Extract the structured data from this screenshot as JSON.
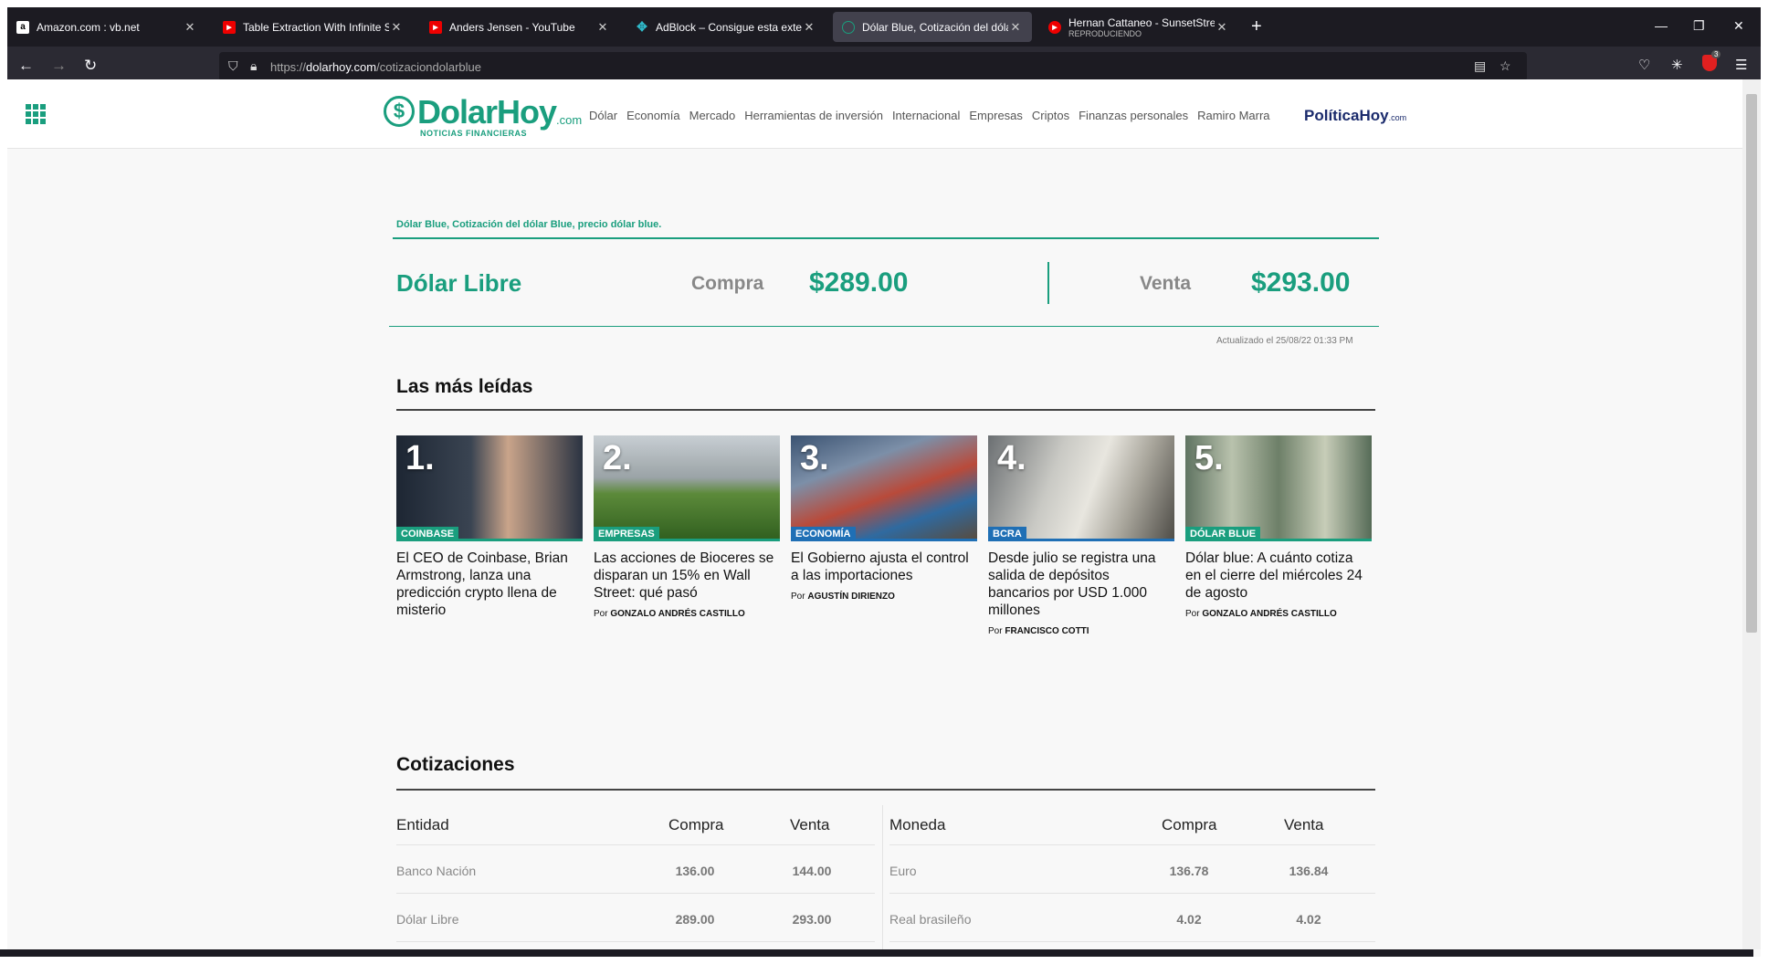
{
  "browser": {
    "tabs": [
      {
        "title": "Amazon.com : vb.net",
        "favicon": "amazon-icon"
      },
      {
        "title": "Table Extraction With Infinite Sc",
        "favicon": "youtube-icon"
      },
      {
        "title": "Anders Jensen - YouTube",
        "favicon": "youtube-icon"
      },
      {
        "title": "AdBlock – Consigue esta extens",
        "favicon": "adblock-icon"
      },
      {
        "title": "Dólar Blue, Cotización del dólar",
        "favicon": "globe-icon",
        "active": true
      },
      {
        "title": "Hernan Cattaneo - SunsetStrean",
        "subtitle": "REPRODUCIENDO",
        "favicon": "youtube-play-icon"
      }
    ],
    "url_prefix": "https://",
    "url_host": "dolarhoy.com",
    "url_path": "/cotizaciondolarblue",
    "extension_badge": "3"
  },
  "site": {
    "logo_main": "DolarHoy",
    "logo_com": ".com",
    "logo_tagline": "NOTICIAS FINANCIERAS",
    "menu": [
      "Dólar",
      "Economía",
      "Mercado",
      "Herramientas de inversión",
      "Internacional",
      "Empresas",
      "Criptos",
      "Finanzas personales",
      "Ramiro Marra"
    ],
    "partner_logo": "PolíticaHoy",
    "partner_com": ".com"
  },
  "quote": {
    "breadcrumb": "Dólar Blue, Cotización del dólar Blue, precio dólar blue.",
    "title": "Dólar Libre",
    "buy_label": "Compra",
    "buy_value": "$289.00",
    "sell_label": "Venta",
    "sell_value": "$293.00",
    "updated": "Actualizado el 25/08/22 01:33 PM"
  },
  "most_read": {
    "title": "Las más leídas",
    "cards": [
      {
        "num": "1.",
        "category": "COINBASE",
        "headline": "El CEO de Coinbase, Brian Armstrong, lanza una predicción crypto llena de misterio",
        "by_prefix": "",
        "author": ""
      },
      {
        "num": "2.",
        "category": "EMPRESAS",
        "headline": "Las acciones de Bioceres se disparan un 15% en Wall Street: qué pasó",
        "by_prefix": "Por",
        "author": "GONZALO ANDRÉS CASTILLO"
      },
      {
        "num": "3.",
        "category": "ECONOMÍA",
        "headline": "El Gobierno ajusta el control a las importaciones",
        "by_prefix": "Por",
        "author": "AGUSTÍN DIRIENZO"
      },
      {
        "num": "4.",
        "category": "BCRA",
        "headline": "Desde julio se registra una salida de depósitos bancarios por USD 1.000 millones",
        "by_prefix": "Por",
        "author": "FRANCISCO COTTI"
      },
      {
        "num": "5.",
        "category": "DÓLAR BLUE",
        "headline": "Dólar blue: A cuánto cotiza en el cierre del miércoles 24 de agosto",
        "by_prefix": "Por",
        "author": "GONZALO ANDRÉS CASTILLO"
      }
    ]
  },
  "quotes_table": {
    "title": "Cotizaciones",
    "left_headers": [
      "Entidad",
      "Compra",
      "Venta"
    ],
    "left_rows": [
      [
        "Banco Nación",
        "136.00",
        "144.00"
      ],
      [
        "Dólar Libre",
        "289.00",
        "293.00"
      ]
    ],
    "right_headers": [
      "Moneda",
      "Compra",
      "Venta"
    ],
    "right_rows": [
      [
        "Euro",
        "136.78",
        "136.84"
      ],
      [
        "Real brasileño",
        "4.02",
        "4.02"
      ]
    ]
  }
}
